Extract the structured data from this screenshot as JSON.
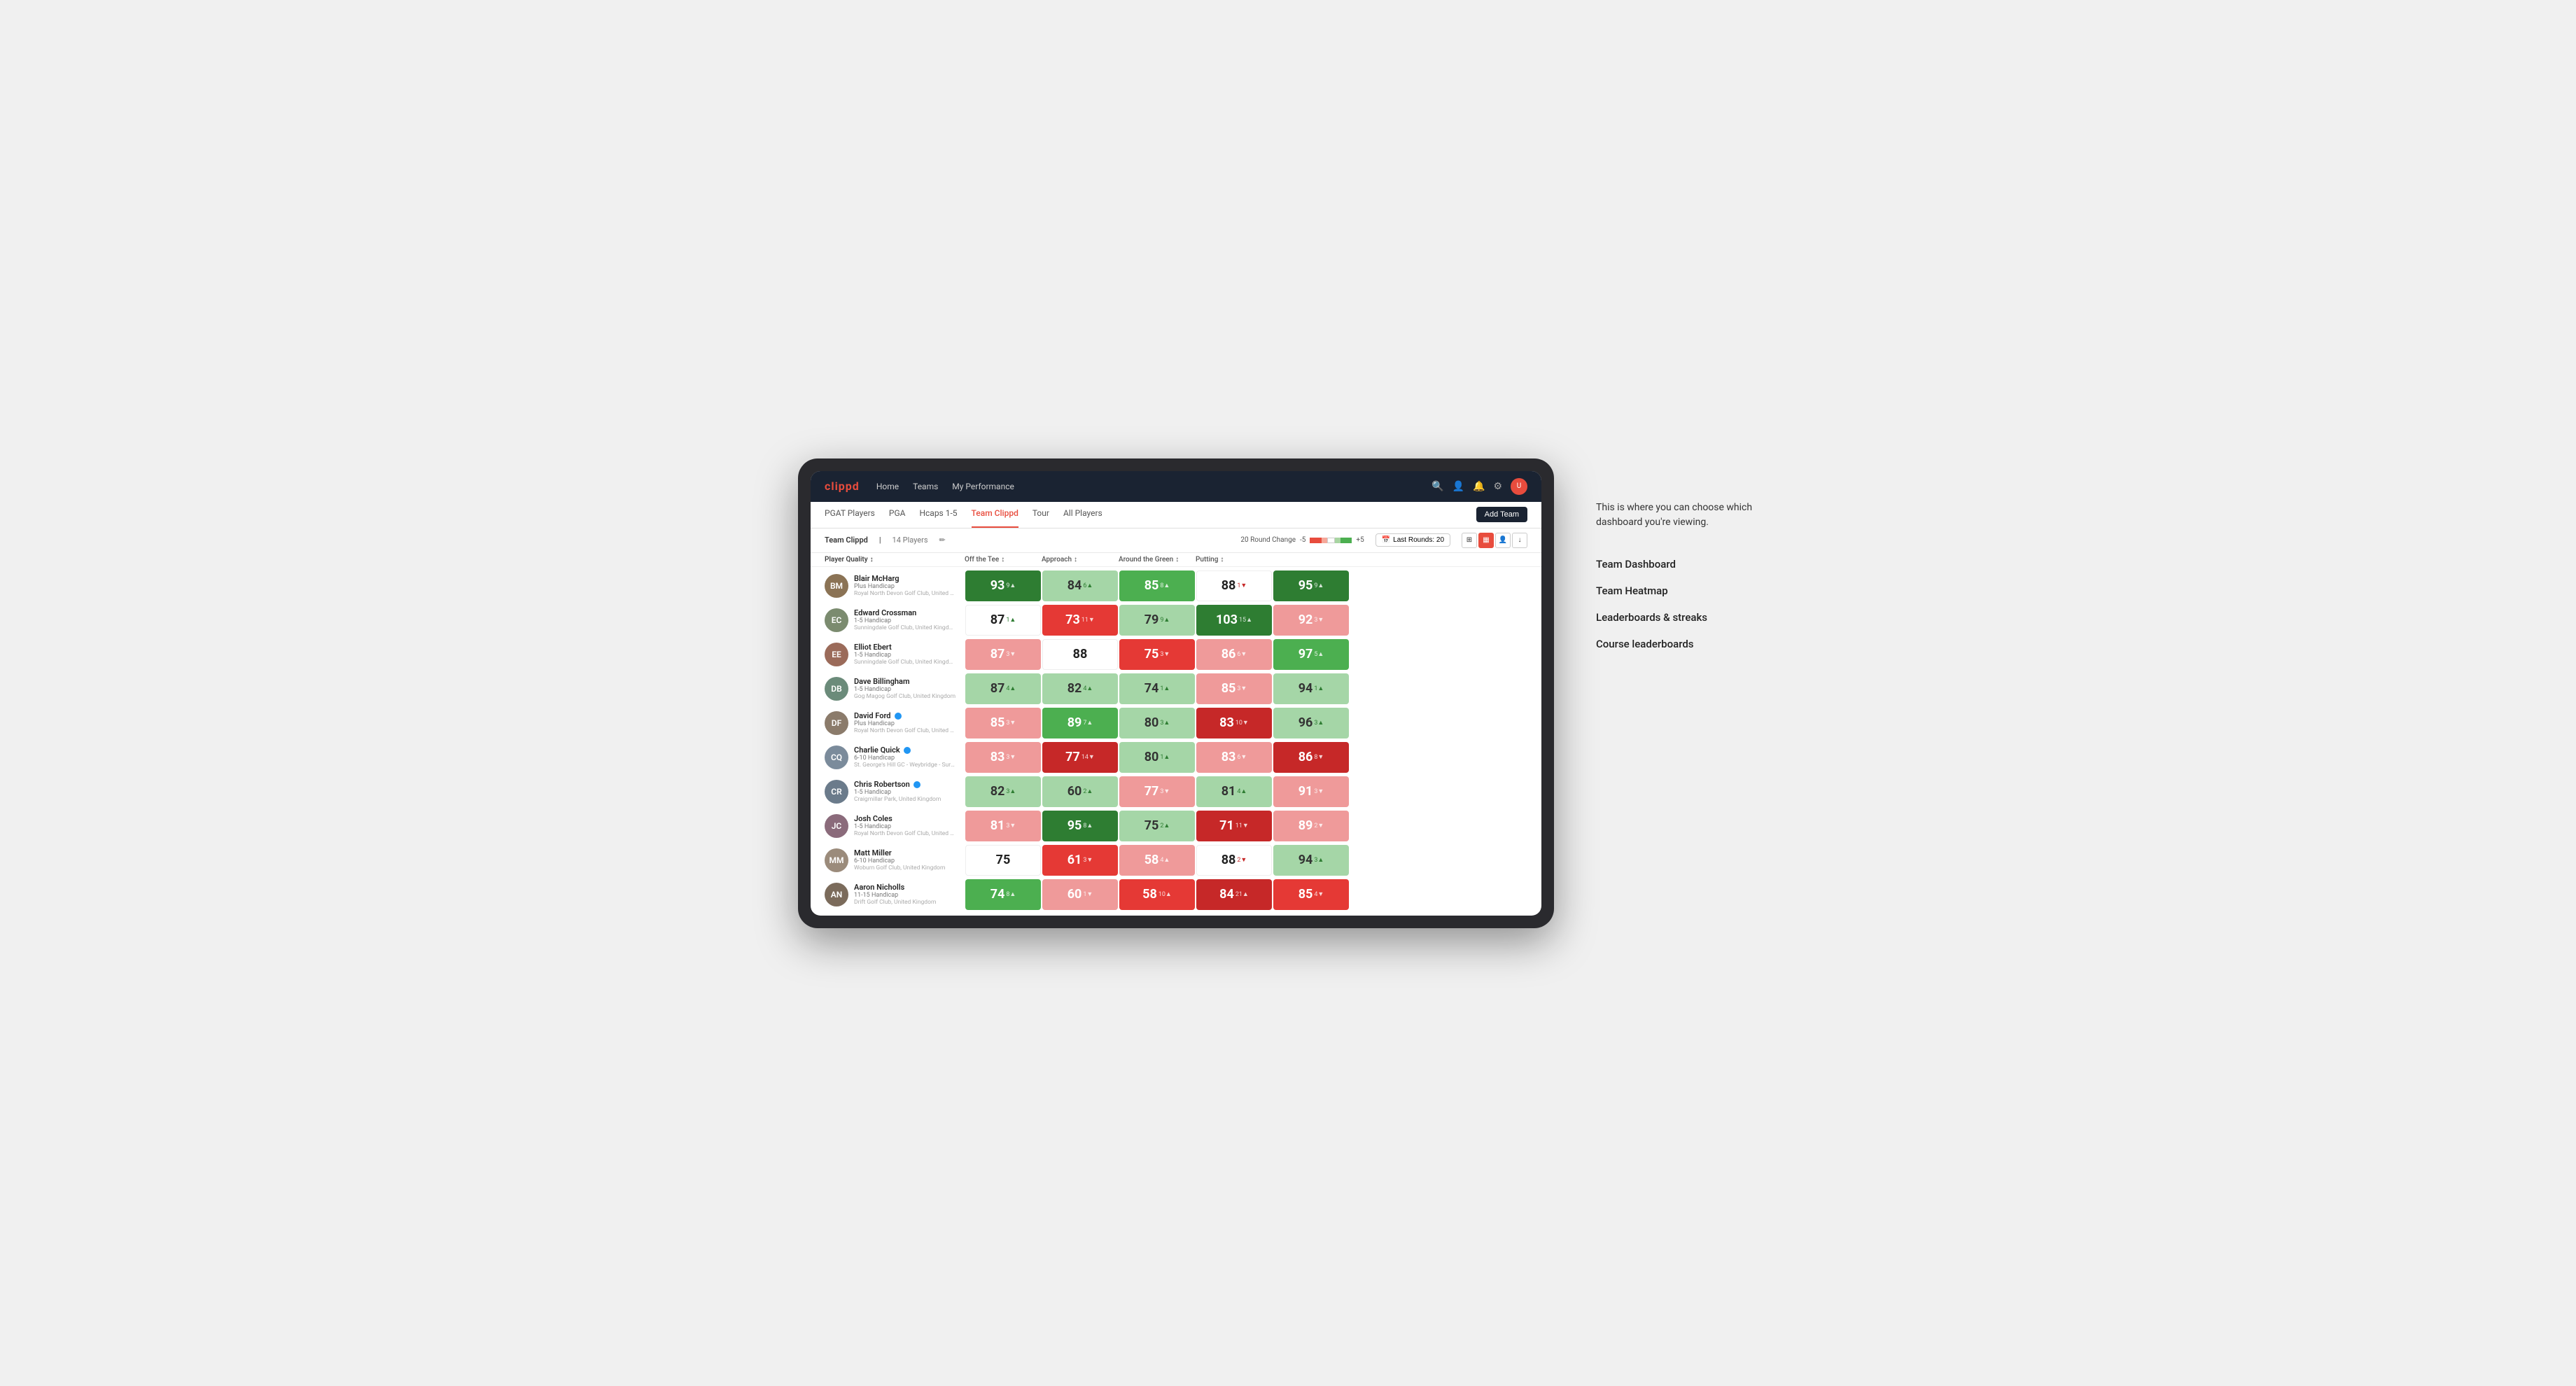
{
  "logo": "clippd",
  "nav": {
    "links": [
      "Home",
      "Teams",
      "My Performance"
    ],
    "icons": [
      "search",
      "person",
      "bell",
      "settings",
      "avatar"
    ]
  },
  "subtabs": {
    "items": [
      "PGAT Players",
      "PGA",
      "Hcaps 1-5",
      "Team Clippd",
      "Tour",
      "All Players"
    ],
    "active": "Team Clippd",
    "add_button": "Add Team"
  },
  "team_header": {
    "name": "Team Clippd",
    "separator": "|",
    "count": "14 Players",
    "round_change_label": "20 Round Change",
    "range_neg": "-5",
    "range_pos": "+5",
    "last_rounds_label": "Last Rounds:",
    "last_rounds_value": "20"
  },
  "columns": [
    {
      "label": "Player Quality",
      "arrow": "↕"
    },
    {
      "label": "Off the Tee",
      "arrow": "↕"
    },
    {
      "label": "Approach",
      "arrow": "↕"
    },
    {
      "label": "Around the Green",
      "arrow": "↕"
    },
    {
      "label": "Putting",
      "arrow": "↕"
    }
  ],
  "players": [
    {
      "name": "Blair McHarg",
      "hcp": "Plus Handicap",
      "club": "Royal North Devon Golf Club, United Kingdom",
      "initials": "BM",
      "color": "#8B7355",
      "scores": [
        {
          "val": "93",
          "change": "9",
          "dir": "up",
          "bg": "bg-green-dark"
        },
        {
          "val": "84",
          "change": "6",
          "dir": "up",
          "bg": "bg-green-light"
        },
        {
          "val": "85",
          "change": "8",
          "dir": "up",
          "bg": "bg-green-mid"
        },
        {
          "val": "88",
          "change": "1",
          "dir": "down",
          "bg": "bg-white"
        },
        {
          "val": "95",
          "change": "9",
          "dir": "up",
          "bg": "bg-green-dark"
        }
      ]
    },
    {
      "name": "Edward Crossman",
      "hcp": "1-5 Handicap",
      "club": "Sunningdale Golf Club, United Kingdom",
      "initials": "EC",
      "color": "#7B8B6F",
      "scores": [
        {
          "val": "87",
          "change": "1",
          "dir": "up",
          "bg": "bg-white"
        },
        {
          "val": "73",
          "change": "11",
          "dir": "down",
          "bg": "bg-red-mid"
        },
        {
          "val": "79",
          "change": "9",
          "dir": "up",
          "bg": "bg-green-light"
        },
        {
          "val": "103",
          "change": "15",
          "dir": "up",
          "bg": "bg-green-dark"
        },
        {
          "val": "92",
          "change": "3",
          "dir": "down",
          "bg": "bg-red-light"
        }
      ]
    },
    {
      "name": "Elliot Ebert",
      "hcp": "1-5 Handicap",
      "club": "Sunningdale Golf Club, United Kingdom",
      "initials": "EE",
      "color": "#9B6B5A",
      "scores": [
        {
          "val": "87",
          "change": "3",
          "dir": "down",
          "bg": "bg-red-light"
        },
        {
          "val": "88",
          "change": "",
          "dir": "",
          "bg": "bg-white"
        },
        {
          "val": "75",
          "change": "3",
          "dir": "down",
          "bg": "bg-red-mid"
        },
        {
          "val": "86",
          "change": "6",
          "dir": "down",
          "bg": "bg-red-light"
        },
        {
          "val": "97",
          "change": "5",
          "dir": "up",
          "bg": "bg-green-mid"
        }
      ]
    },
    {
      "name": "Dave Billingham",
      "hcp": "1-5 Handicap",
      "club": "Gog Magog Golf Club, United Kingdom",
      "initials": "DB",
      "color": "#6B8B7A",
      "scores": [
        {
          "val": "87",
          "change": "4",
          "dir": "up",
          "bg": "bg-green-light"
        },
        {
          "val": "82",
          "change": "4",
          "dir": "up",
          "bg": "bg-green-light"
        },
        {
          "val": "74",
          "change": "1",
          "dir": "up",
          "bg": "bg-green-light"
        },
        {
          "val": "85",
          "change": "3",
          "dir": "down",
          "bg": "bg-red-light"
        },
        {
          "val": "94",
          "change": "1",
          "dir": "up",
          "bg": "bg-green-light"
        }
      ]
    },
    {
      "name": "David Ford",
      "hcp": "Plus Handicap",
      "club": "Royal North Devon Golf Club, United Kingdom",
      "initials": "DF",
      "color": "#8B7B6B",
      "verified": true,
      "scores": [
        {
          "val": "85",
          "change": "3",
          "dir": "down",
          "bg": "bg-red-light"
        },
        {
          "val": "89",
          "change": "7",
          "dir": "up",
          "bg": "bg-green-mid"
        },
        {
          "val": "80",
          "change": "3",
          "dir": "up",
          "bg": "bg-green-light"
        },
        {
          "val": "83",
          "change": "10",
          "dir": "down",
          "bg": "bg-red-dark"
        },
        {
          "val": "96",
          "change": "3",
          "dir": "up",
          "bg": "bg-green-light"
        }
      ]
    },
    {
      "name": "Charlie Quick",
      "hcp": "6-10 Handicap",
      "club": "St. George's Hill GC - Weybridge - Surrey, Uni...",
      "initials": "CQ",
      "color": "#7B8B9B",
      "verified": true,
      "scores": [
        {
          "val": "83",
          "change": "3",
          "dir": "down",
          "bg": "bg-red-light"
        },
        {
          "val": "77",
          "change": "14",
          "dir": "down",
          "bg": "bg-red-dark"
        },
        {
          "val": "80",
          "change": "1",
          "dir": "up",
          "bg": "bg-green-light"
        },
        {
          "val": "83",
          "change": "6",
          "dir": "down",
          "bg": "bg-red-light"
        },
        {
          "val": "86",
          "change": "8",
          "dir": "down",
          "bg": "bg-red-dark"
        }
      ]
    },
    {
      "name": "Chris Robertson",
      "hcp": "1-5 Handicap",
      "club": "Craigmillar Park, United Kingdom",
      "initials": "CR",
      "color": "#6B7B8B",
      "verified": true,
      "scores": [
        {
          "val": "82",
          "change": "3",
          "dir": "up",
          "bg": "bg-green-light"
        },
        {
          "val": "60",
          "change": "2",
          "dir": "up",
          "bg": "bg-green-light"
        },
        {
          "val": "77",
          "change": "3",
          "dir": "down",
          "bg": "bg-red-light"
        },
        {
          "val": "81",
          "change": "4",
          "dir": "up",
          "bg": "bg-green-light"
        },
        {
          "val": "91",
          "change": "3",
          "dir": "down",
          "bg": "bg-red-light"
        }
      ]
    },
    {
      "name": "Josh Coles",
      "hcp": "1-5 Handicap",
      "club": "Royal North Devon Golf Club, United Kingdom",
      "initials": "JC",
      "color": "#8B6B7B",
      "scores": [
        {
          "val": "81",
          "change": "3",
          "dir": "down",
          "bg": "bg-red-light"
        },
        {
          "val": "95",
          "change": "8",
          "dir": "up",
          "bg": "bg-green-dark"
        },
        {
          "val": "75",
          "change": "2",
          "dir": "up",
          "bg": "bg-green-light"
        },
        {
          "val": "71",
          "change": "11",
          "dir": "down",
          "bg": "bg-red-dark"
        },
        {
          "val": "89",
          "change": "2",
          "dir": "down",
          "bg": "bg-red-light"
        }
      ]
    },
    {
      "name": "Matt Miller",
      "hcp": "6-10 Handicap",
      "club": "Woburn Golf Club, United Kingdom",
      "initials": "MM",
      "color": "#9B8B7B",
      "scores": [
        {
          "val": "75",
          "change": "",
          "dir": "",
          "bg": "bg-white"
        },
        {
          "val": "61",
          "change": "3",
          "dir": "down",
          "bg": "bg-red-mid"
        },
        {
          "val": "58",
          "change": "4",
          "dir": "up",
          "bg": "bg-red-light"
        },
        {
          "val": "88",
          "change": "2",
          "dir": "down",
          "bg": "bg-white"
        },
        {
          "val": "94",
          "change": "3",
          "dir": "up",
          "bg": "bg-green-light"
        }
      ]
    },
    {
      "name": "Aaron Nicholls",
      "hcp": "11-15 Handicap",
      "club": "Drift Golf Club, United Kingdom",
      "initials": "AN",
      "color": "#7B6B5B",
      "scores": [
        {
          "val": "74",
          "change": "8",
          "dir": "up",
          "bg": "bg-green-mid"
        },
        {
          "val": "60",
          "change": "1",
          "dir": "down",
          "bg": "bg-red-light"
        },
        {
          "val": "58",
          "change": "10",
          "dir": "up",
          "bg": "bg-red-mid"
        },
        {
          "val": "84",
          "change": "21",
          "dir": "up",
          "bg": "bg-red-dark"
        },
        {
          "val": "85",
          "change": "4",
          "dir": "down",
          "bg": "bg-red-mid"
        }
      ]
    }
  ],
  "annotation": {
    "intro": "This is where you can choose which dashboard you're viewing.",
    "items": [
      "Team Dashboard",
      "Team Heatmap",
      "Leaderboards & streaks",
      "Course leaderboards"
    ]
  }
}
